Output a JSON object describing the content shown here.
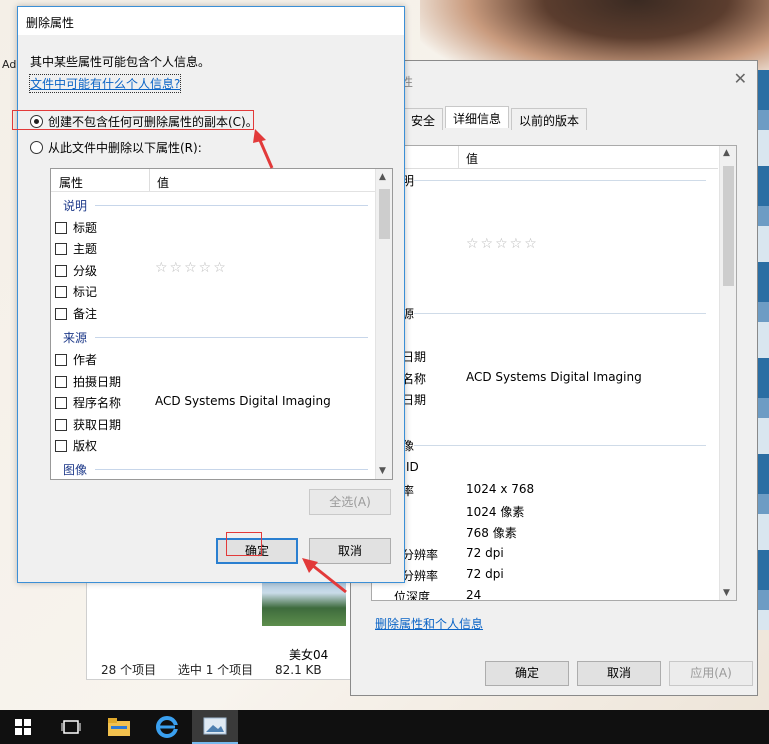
{
  "desktop": {
    "edge_label": "Ad"
  },
  "explorer": {
    "thumb_caption": "美女04",
    "status": {
      "items_count": "28 个项目",
      "selected": "选中 1 个项目",
      "size": "82.1 KB"
    }
  },
  "properties_window": {
    "title_fragment": "性",
    "tabs": [
      "安全",
      "详细信息",
      "以前的版本"
    ],
    "active_tab": "详细信息",
    "column_header_value": "值",
    "rows": [
      {
        "label": "明",
        "value": ""
      },
      {
        "label": "源",
        "value": ""
      },
      {
        "label": "日期",
        "value": ""
      },
      {
        "label": "名称",
        "value": "ACD Systems Digital Imaging"
      },
      {
        "label": "日期",
        "value": ""
      },
      {
        "label": "像",
        "value": ""
      },
      {
        "label": "ID",
        "value": ""
      },
      {
        "label": "率",
        "value": "1024 x 768"
      },
      {
        "label": "",
        "value": "1024 像素"
      },
      {
        "label": "",
        "value": "768 像素"
      },
      {
        "label": "分辨率",
        "value": "72 dpi"
      },
      {
        "label": "分辨率",
        "value": "72 dpi"
      },
      {
        "label": "位深度",
        "value": "24"
      }
    ],
    "stars": "☆☆☆☆☆",
    "remove_link": "删除属性和个人信息",
    "buttons": {
      "ok": "确定",
      "cancel": "取消",
      "apply": "应用(A)"
    }
  },
  "remove_dialog": {
    "title": "删除属性",
    "intro": "其中某些属性可能包含个人信息。",
    "info_link": "文件中可能有什么个人信息?",
    "option_copy": "创建不包含任何可删除属性的副本(C)。",
    "option_remove": "从此文件中删除以下属性(R):",
    "selected_option": "option_copy",
    "list": {
      "col_property": "属性",
      "col_value": "值",
      "group_description": "说明",
      "group_origin": "来源",
      "group_image": "图像",
      "items_description": [
        {
          "label": "标题",
          "value": ""
        },
        {
          "label": "主题",
          "value": ""
        },
        {
          "label": "分级",
          "value": "☆☆☆☆☆"
        },
        {
          "label": "标记",
          "value": ""
        },
        {
          "label": "备注",
          "value": ""
        }
      ],
      "items_origin": [
        {
          "label": "作者",
          "value": ""
        },
        {
          "label": "拍摄日期",
          "value": ""
        },
        {
          "label": "程序名称",
          "value": "ACD Systems Digital Imaging"
        },
        {
          "label": "获取日期",
          "value": ""
        },
        {
          "label": "版权",
          "value": ""
        }
      ]
    },
    "buttons": {
      "select_all": "全选(A)",
      "ok": "确定",
      "cancel": "取消"
    }
  },
  "annotations": {
    "highlight_color": "#e23a3a"
  },
  "taskbar": {
    "items": [
      "start-icon",
      "task-view-icon",
      "file-explorer-icon",
      "edge-icon",
      "photos-icon"
    ]
  }
}
